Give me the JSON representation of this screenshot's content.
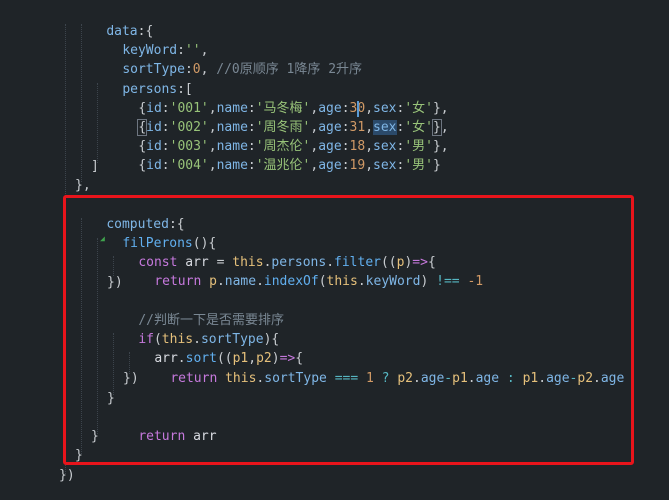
{
  "code_lines": [
    {
      "t": "data_open",
      "text": "data:{"
    },
    {
      "t": "keyword",
      "key": "keyWord",
      "val": "''"
    },
    {
      "t": "sorttype",
      "key": "sortType",
      "val": "0",
      "comment": "//0原顺序 1降序 2升序"
    },
    {
      "t": "persons",
      "key": "persons",
      "open": "["
    },
    {
      "t": "person",
      "id": "'001'",
      "name": "'马冬梅'",
      "age": "30",
      "sex": "'女'"
    },
    {
      "t": "person",
      "id": "'002'",
      "name": "'周冬雨'",
      "age": "31",
      "sex": "'女'"
    },
    {
      "t": "person",
      "id": "'003'",
      "name": "'周杰伦'",
      "age": "18",
      "sex": "'男'"
    },
    {
      "t": "person",
      "id": "'004'",
      "name": "'温兆伦'",
      "age": "19",
      "sex": "'男'"
    },
    {
      "t": "close",
      "text": "]"
    },
    {
      "t": "close",
      "text": "},"
    },
    {
      "t": "computed",
      "text": "computed:{"
    },
    {
      "t": "fn",
      "text": "filPerons(){"
    },
    {
      "t": "const",
      "text": "const arr = this.persons.filter((p)=>{"
    },
    {
      "t": "return1",
      "text": "return p.name.indexOf(this.keyWord) !== -1"
    },
    {
      "t": "close",
      "text": "})"
    },
    {
      "t": "comment",
      "text": "//判断一下是否需要排序"
    },
    {
      "t": "if",
      "text": "if(this.sortType){"
    },
    {
      "t": "sort",
      "text": "arr.sort((p1,p2)=>{"
    },
    {
      "t": "return2",
      "text": "return this.sortType === 1 ? p2.age-p1.age : p1.age-p2.age"
    },
    {
      "t": "close",
      "text": "})"
    },
    {
      "t": "close",
      "text": "}"
    },
    {
      "t": "return3",
      "text": "return arr"
    },
    {
      "t": "close",
      "text": "}"
    },
    {
      "t": "close",
      "text": "}"
    },
    {
      "t": "close",
      "text": "})"
    }
  ],
  "strings": {
    "data_open": "data:{",
    "keyword_key": "keyWord",
    "keyword_val": "''",
    "sorttype_key": "sortType",
    "sorttype_val": "0",
    "sorttype_comment": "//0原顺序 1降序 2升序",
    "persons_key": "persons",
    "p1_id": "'001'",
    "p1_name": "'马冬梅'",
    "p1_age": "30",
    "p1_sex": "'女'",
    "p2_id": "'002'",
    "p2_name": "'周冬雨'",
    "p2_age": "31",
    "p2_sex": "'女'",
    "p3_id": "'003'",
    "p3_name": "'周杰伦'",
    "p3_age": "18",
    "p3_sex": "'男'",
    "p4_id": "'004'",
    "p4_name": "'温兆伦'",
    "p4_age": "19",
    "p4_sex": "'男'",
    "computed_key": "computed",
    "fn_name": "filPerons",
    "arr_var": "arr",
    "persons_prop": "persons",
    "filter_fn": "filter",
    "p_param": "p",
    "name_prop": "name",
    "indexof_fn": "indexOf",
    "keyword_prop": "keyWord",
    "minus_one": "-1",
    "comment_sort": "//判断一下是否需要排序",
    "sorttype_prop": "sortType",
    "sort_fn": "sort",
    "p1_param": "p1",
    "p2_param": "p2",
    "one_val": "1",
    "age_prop": "age"
  }
}
